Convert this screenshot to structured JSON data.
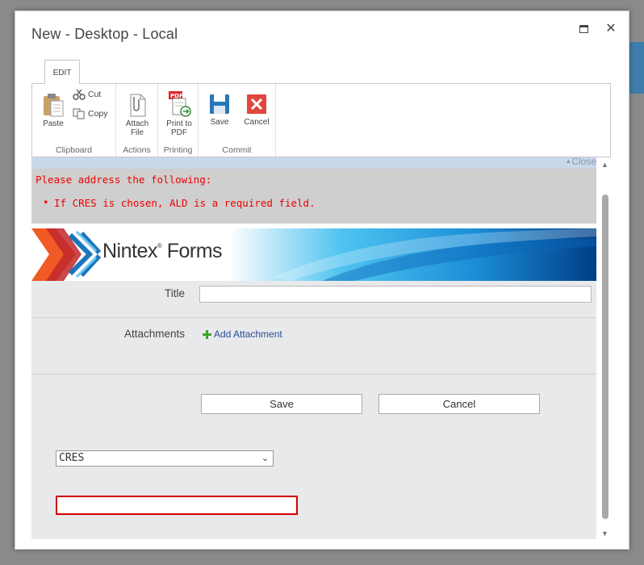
{
  "window": {
    "title": "New - Desktop - Local"
  },
  "ribbon": {
    "tab_edit": "EDIT",
    "clipboard": {
      "paste": "Paste",
      "cut": "Cut",
      "copy": "Copy",
      "label": "Clipboard"
    },
    "actions": {
      "attach_line1": "Attach",
      "attach_line2": "File",
      "label": "Actions"
    },
    "printing": {
      "print_line1": "Print to",
      "print_line2": "PDF",
      "label": "Printing"
    },
    "commit": {
      "save": "Save",
      "cancel": "Cancel",
      "label": "Commit"
    }
  },
  "status": {
    "close_link": "Close"
  },
  "errors": {
    "heading": "Please address the following:",
    "items": [
      "If CRES is chosen, ALD is a required field."
    ]
  },
  "banner": {
    "brand": "Nintex",
    "product": "Forms",
    "registered": "®"
  },
  "form": {
    "title_label": "Title",
    "title_value": "",
    "attachments_label": "Attachments",
    "add_attachment": "Add Attachment",
    "save_button": "Save",
    "cancel_button": "Cancel",
    "dropdown_selected": "CRES",
    "ald_value": ""
  },
  "colors": {
    "error": "#ee0000",
    "accent": "#0072c6",
    "invalid_border": "#d40000"
  }
}
